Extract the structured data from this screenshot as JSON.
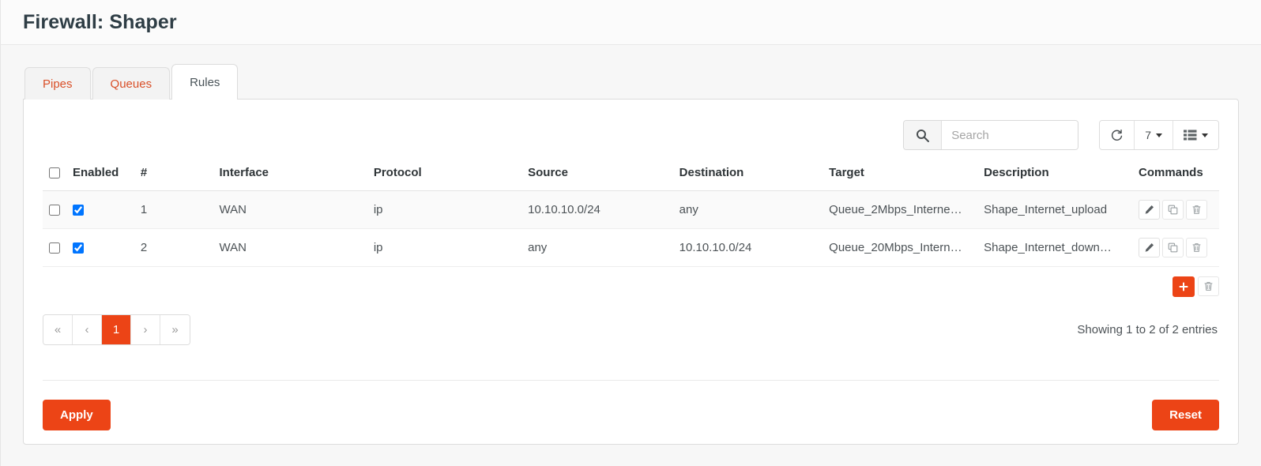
{
  "header": {
    "title": "Firewall: Shaper"
  },
  "tabs": [
    {
      "label": "Pipes",
      "active": false
    },
    {
      "label": "Queues",
      "active": false
    },
    {
      "label": "Rules",
      "active": true
    }
  ],
  "toolbar": {
    "search_placeholder": "Search",
    "search_value": "",
    "search_icon": "search-icon",
    "refresh_icon": "refresh-icon",
    "page_size_label": "7",
    "columns_icon": "columns-list-icon"
  },
  "table": {
    "columns": [
      "",
      "Enabled",
      "#",
      "Interface",
      "Protocol",
      "Source",
      "Destination",
      "Target",
      "Description",
      "Commands"
    ],
    "select_all_checked": false,
    "rows": [
      {
        "selected": false,
        "enabled": true,
        "num": "1",
        "interface": "WAN",
        "protocol": "ip",
        "source": "10.10.10.0/24",
        "destination": "any",
        "target": "Queue_2Mbps_Interne…",
        "description": "Shape_Internet_upload"
      },
      {
        "selected": false,
        "enabled": true,
        "num": "2",
        "interface": "WAN",
        "protocol": "ip",
        "source": "any",
        "destination": "10.10.10.0/24",
        "target": "Queue_20Mbps_Intern…",
        "description": "Shape_Internet_down…"
      }
    ],
    "row_commands": {
      "edit_icon": "pencil-icon",
      "clone_icon": "copy-icon",
      "delete_icon": "trash-icon"
    },
    "add_icon": "plus-icon",
    "delete_selected_icon": "trash-icon"
  },
  "pagination": {
    "first_label": "«",
    "prev_label": "‹",
    "pages": [
      "1"
    ],
    "active_page": "1",
    "next_label": "›",
    "last_label": "»",
    "showing_text": "Showing 1 to 2 of 2 entries"
  },
  "footer": {
    "apply_label": "Apply",
    "reset_label": "Reset"
  },
  "colors": {
    "accent": "#ec4416",
    "tab_link": "#d94f28",
    "title": "#2e3d45",
    "page_bg": "#f7f7f7"
  }
}
